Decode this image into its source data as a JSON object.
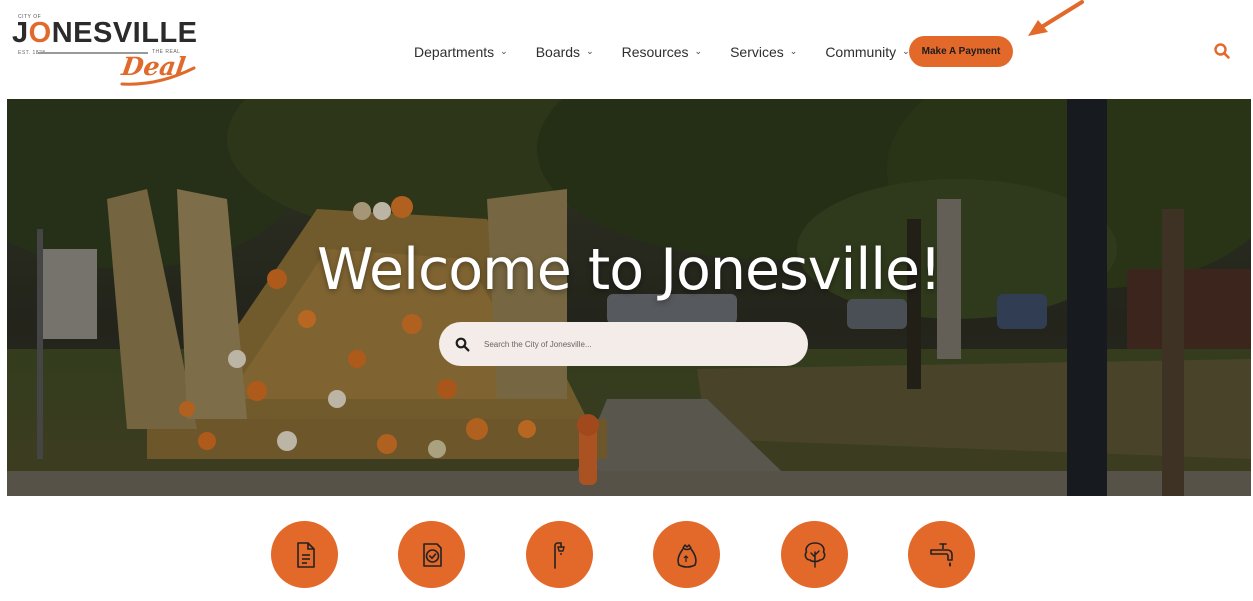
{
  "brand": {
    "city_of": "CITY OF",
    "name_part1": "J",
    "name_part2": "O",
    "name_part3": "NESVILLE",
    "est": "EST. 1828",
    "the_real": "THE REAL",
    "deal": "Deal"
  },
  "nav": {
    "items": [
      {
        "label": "Departments",
        "chevron": "chevron-down-icon"
      },
      {
        "label": "Boards",
        "chevron": "chevron-down-icon"
      },
      {
        "label": "Resources",
        "chevron": "chevron-down-icon"
      },
      {
        "label": "Services",
        "chevron": "chevron-down-icon"
      },
      {
        "label": "Community",
        "chevron": "chevron-down-icon"
      }
    ],
    "payment_button": "Make A Payment",
    "search_icon": "search-icon"
  },
  "hero": {
    "title": "Welcome to Jonesville!",
    "search_placeholder": "Search the City of Jonesville..."
  },
  "quick_links": [
    {
      "icon": "document-icon"
    },
    {
      "icon": "badge-check-icon"
    },
    {
      "icon": "street-light-icon"
    },
    {
      "icon": "trash-bag-icon"
    },
    {
      "icon": "tree-icon"
    },
    {
      "icon": "water-faucet-icon"
    }
  ],
  "colors": {
    "accent": "#e3692b",
    "text_dark": "#2e2e2e",
    "search_bg": "#f4ece8"
  }
}
